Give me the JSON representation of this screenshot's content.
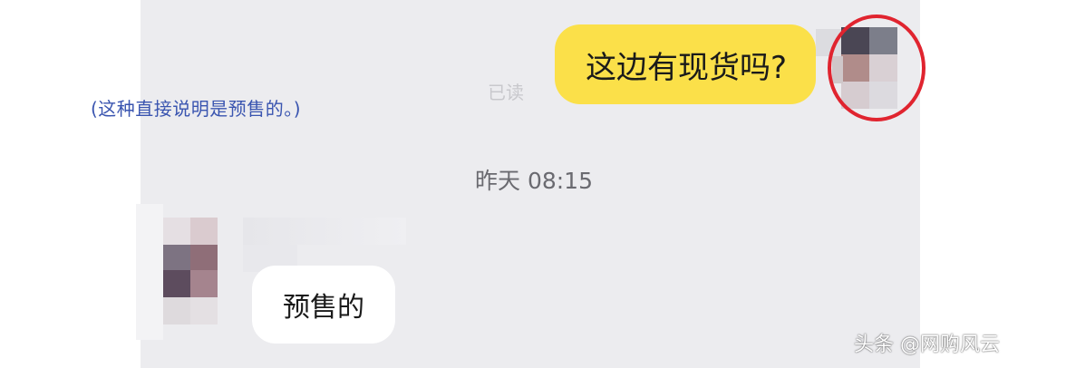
{
  "annotation": "(这种直接说明是预售的。)",
  "outgoing_message": {
    "text": "这边有现货吗?",
    "status": "已读"
  },
  "timestamp": "昨天  08:15",
  "incoming_message": {
    "text": "预售的"
  },
  "watermark": "头条 @网购风云",
  "colors": {
    "chat_background": "#ececef",
    "outgoing_bubble": "#fbe049",
    "incoming_bubble": "#ffffff",
    "annotation_text": "#3a55b0",
    "highlight_circle": "#e0242f"
  },
  "avatars": {
    "self": {
      "icon": "avatar-icon",
      "pixelated": true
    },
    "other": {
      "icon": "avatar-icon",
      "pixelated": true
    }
  }
}
